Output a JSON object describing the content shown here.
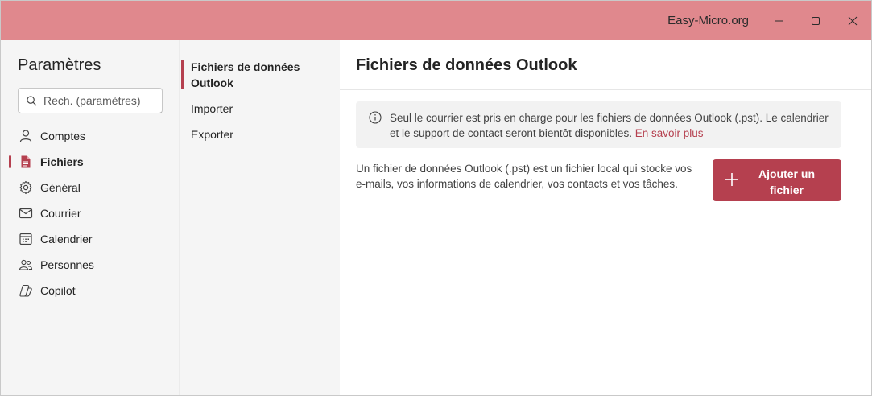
{
  "window": {
    "title": "Easy-Micro.org",
    "controls": [
      "minimize-icon",
      "maximize-icon",
      "close-icon"
    ]
  },
  "sidebar": {
    "title": "Paramètres",
    "search_placeholder": "Rech. (paramètres)",
    "items": [
      {
        "label": "Comptes",
        "icon": "person-icon"
      },
      {
        "label": "Fichiers",
        "icon": "document-icon",
        "active": true
      },
      {
        "label": "Général",
        "icon": "gear-icon"
      },
      {
        "label": "Courrier",
        "icon": "mail-icon"
      },
      {
        "label": "Calendrier",
        "icon": "calendar-icon"
      },
      {
        "label": "Personnes",
        "icon": "people-icon"
      },
      {
        "label": "Copilot",
        "icon": "copilot-icon"
      }
    ]
  },
  "subnav": {
    "items": [
      {
        "label_line1": "Fichiers de données",
        "label_line2": "Outlook",
        "active": true
      },
      {
        "label": "Importer"
      },
      {
        "label": "Exporter"
      }
    ]
  },
  "main": {
    "title": "Fichiers de données Outlook",
    "info_text": "Seul le courrier est pris en charge pour les fichiers de données Outlook (.pst). Le calendrier et le support de contact seront bientôt disponibles.",
    "info_link": "En savoir plus",
    "description": "Un fichier de données Outlook (.pst) est un fichier local qui stocke vos e-mails, vos informations de calendrier, vos contacts et vos tâches.",
    "add_button_label": "Ajouter un fichier"
  },
  "colors": {
    "titlebar": "#e0888d",
    "accent": "#b5404f"
  }
}
